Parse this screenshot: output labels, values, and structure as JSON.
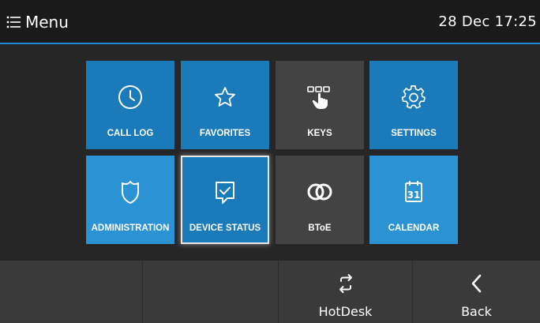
{
  "header": {
    "menu_title": "Menu",
    "datetime": "28 Dec 17:25"
  },
  "tiles": [
    {
      "label": "CALL LOG",
      "icon": "clock-icon"
    },
    {
      "label": "FAVORITES",
      "icon": "star-icon"
    },
    {
      "label": "KEYS",
      "icon": "keys-icon"
    },
    {
      "label": "SETTINGS",
      "icon": "gear-icon"
    },
    {
      "label": "ADMINISTRATION",
      "icon": "shield-icon"
    },
    {
      "label": "DEVICE STATUS",
      "icon": "device-status-icon"
    },
    {
      "label": "BToE",
      "icon": "btoe-icon"
    },
    {
      "label": "CALENDAR",
      "icon": "calendar-icon",
      "day": "31"
    }
  ],
  "softkeys": [
    {
      "label": ""
    },
    {
      "label": ""
    },
    {
      "label": "HotDesk",
      "icon": "swap-arrows-icon"
    },
    {
      "label": "Back",
      "icon": "chevron-left-icon"
    }
  ],
  "colors": {
    "accent": "#1c8ad6",
    "tile_blue": "#1b7ab9",
    "tile_light_blue": "#2b92d3",
    "tile_gray": "#434343",
    "softkey_bar": "#3a3a3a"
  }
}
